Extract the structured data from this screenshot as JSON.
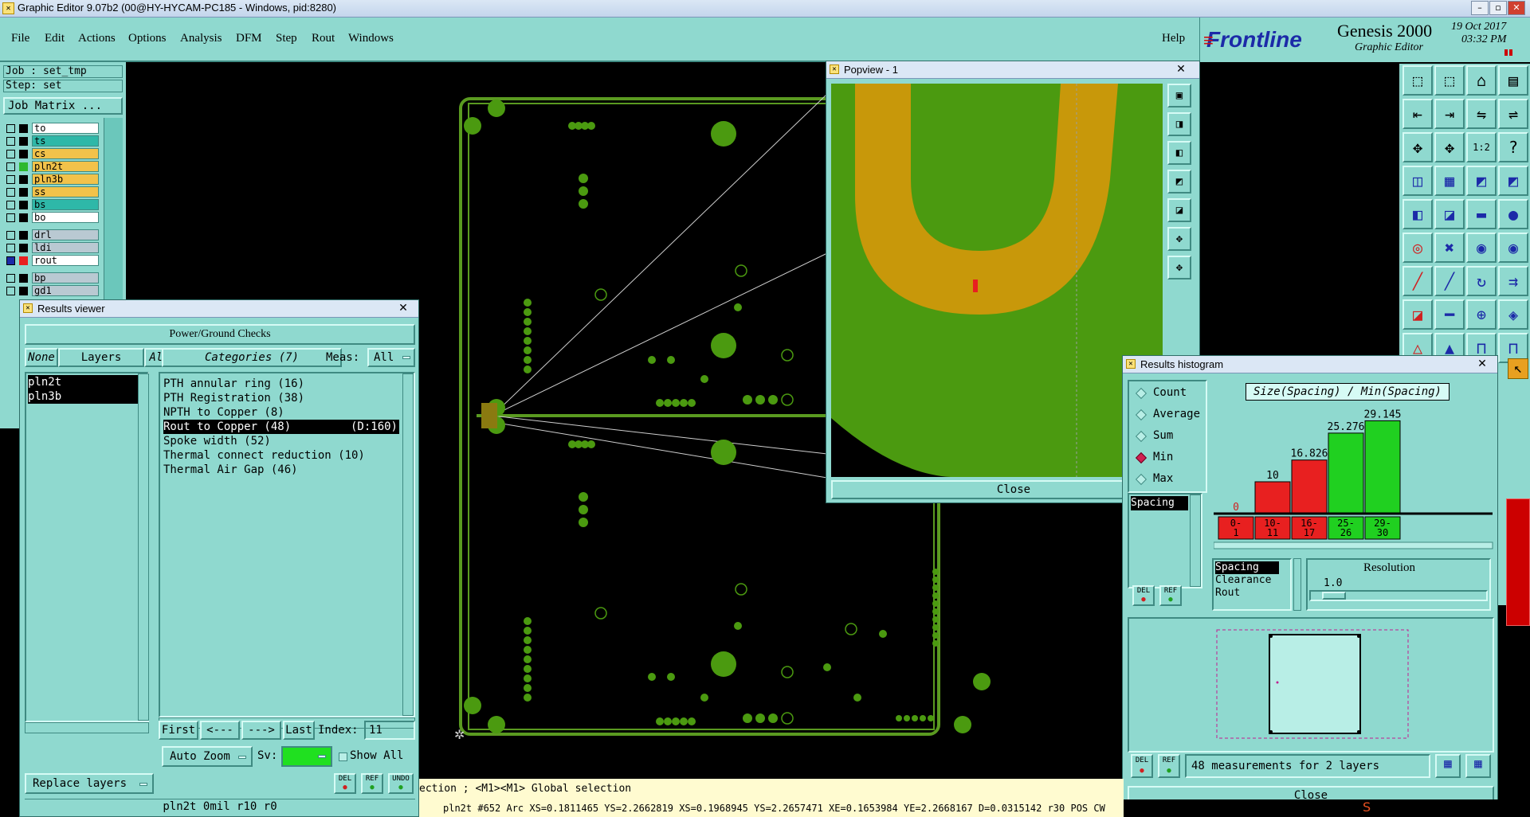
{
  "window": {
    "title": "Graphic Editor 9.07b2 (00@HY-HYCAM-PC185 - Windows, pid:8280)"
  },
  "menu": {
    "items": [
      "File",
      "Edit",
      "Actions",
      "Options",
      "Analysis",
      "DFM",
      "Step",
      "Rout",
      "Windows"
    ],
    "help": "Help"
  },
  "brand": {
    "logo": "Frontline",
    "product": "Genesis 2000",
    "subtitle": "Graphic Editor",
    "date": "19 Oct 2017",
    "time": "03:32 PM"
  },
  "job": {
    "job_label": "Job : set_tmp",
    "step_label": "Step: set",
    "matrix_button": "Job Matrix ..."
  },
  "layers": [
    {
      "name": "to",
      "color": "#ffffff"
    },
    {
      "name": "ts",
      "color": "#2eb8a8"
    },
    {
      "name": "cs",
      "color": "#f2c24a"
    },
    {
      "name": "pln2t",
      "color": "#f2c24a"
    },
    {
      "name": "pln3b",
      "color": "#f2c24a"
    },
    {
      "name": "ss",
      "color": "#f2c24a"
    },
    {
      "name": "bs",
      "color": "#2eb8a8"
    },
    {
      "name": "bo",
      "color": "#ffffff"
    },
    {
      "name": "drl",
      "color": "#b9c9d2"
    },
    {
      "name": "ldi",
      "color": "#b9c9d2"
    },
    {
      "name": "rout",
      "color": "#ffffff"
    },
    {
      "name": "bp",
      "color": "#b9c9d2"
    },
    {
      "name": "gd1",
      "color": "#b9c9d2"
    }
  ],
  "results_viewer": {
    "title": "Results viewer",
    "header": "Power/Ground Checks",
    "none_btn": "None",
    "layers_btn": "Layers",
    "all_btn": "All",
    "categories_btn": "Categories (7)",
    "meas_label": "Meas:",
    "meas_value": "All",
    "layer_list": [
      "pln2t",
      "pln3b"
    ],
    "categories": [
      {
        "label": "PTH annular ring (16)",
        "extra": ""
      },
      {
        "label": "PTH Registration (38)",
        "extra": ""
      },
      {
        "label": "NPTH to Copper (8)",
        "extra": ""
      },
      {
        "label": "Rout to Copper (48)",
        "extra": "(D:160)",
        "selected": true
      },
      {
        "label": "Spoke width (52)",
        "extra": ""
      },
      {
        "label": "Thermal connect reduction (10)",
        "extra": ""
      },
      {
        "label": "Thermal Air Gap (46)",
        "extra": ""
      }
    ],
    "nav": {
      "first": "First",
      "prev": "<---",
      "next": "--->",
      "last": "Last",
      "index_label": "Index:",
      "index_value": "11"
    },
    "auto_zoom": "Auto Zoom",
    "sv_label": "Sv:",
    "show_all": "Show All",
    "replace_layers": "Replace layers",
    "small_btns": [
      "DEL",
      "REF",
      "UNDO"
    ],
    "status": "pln2t  0mil   r10   r0"
  },
  "popview": {
    "title": "Popview - 1",
    "close": "Close"
  },
  "histogram": {
    "title": "Results histogram",
    "modes": [
      "Count",
      "Average",
      "Sum",
      "Min",
      "Max"
    ],
    "selected_mode": "Min",
    "left_list": [
      "Spacing"
    ],
    "chart_title": "Size(Spacing) / Min(Spacing)",
    "bars": [
      {
        "bin": "0-\n1",
        "value": "0",
        "color": "#e82020"
      },
      {
        "bin": "10-\n11",
        "value": "10",
        "color": "#e82020"
      },
      {
        "bin": "16-\n17",
        "value": "16.826",
        "color": "#e82020"
      },
      {
        "bin": "25-\n26",
        "value": "25.276",
        "color": "#20d020"
      },
      {
        "bin": "29-\n30",
        "value": "29.145",
        "color": "#20d020"
      }
    ],
    "bin_labels": [
      [
        "0-",
        "1"
      ],
      [
        "10-",
        "11"
      ],
      [
        "16-",
        "17"
      ],
      [
        "25-",
        "26"
      ],
      [
        "29-",
        "30"
      ]
    ],
    "type_list": [
      "Spacing",
      "Clearance",
      "Rout"
    ],
    "resolution_label": "Resolution",
    "resolution_value": "1.0",
    "measurements": "48 measurements for 2 layers",
    "close": "Close",
    "del": "DEL",
    "ref": "REF"
  },
  "status_bar": {
    "line1": "ection ; <M1><M1> Global selection",
    "line2": "pln2t #652 Arc XS=0.1811465 YS=2.2662819 XS=0.1968945 YS=2.2657471 XE=0.1653984 YE=2.2668167 D=0.0315142 r30 POS CW"
  },
  "colors": {
    "panel": "#8fd9cf",
    "copper_green": "#4b9a10",
    "rout_gold": "#c8980a",
    "accent_red": "#cc0000"
  }
}
